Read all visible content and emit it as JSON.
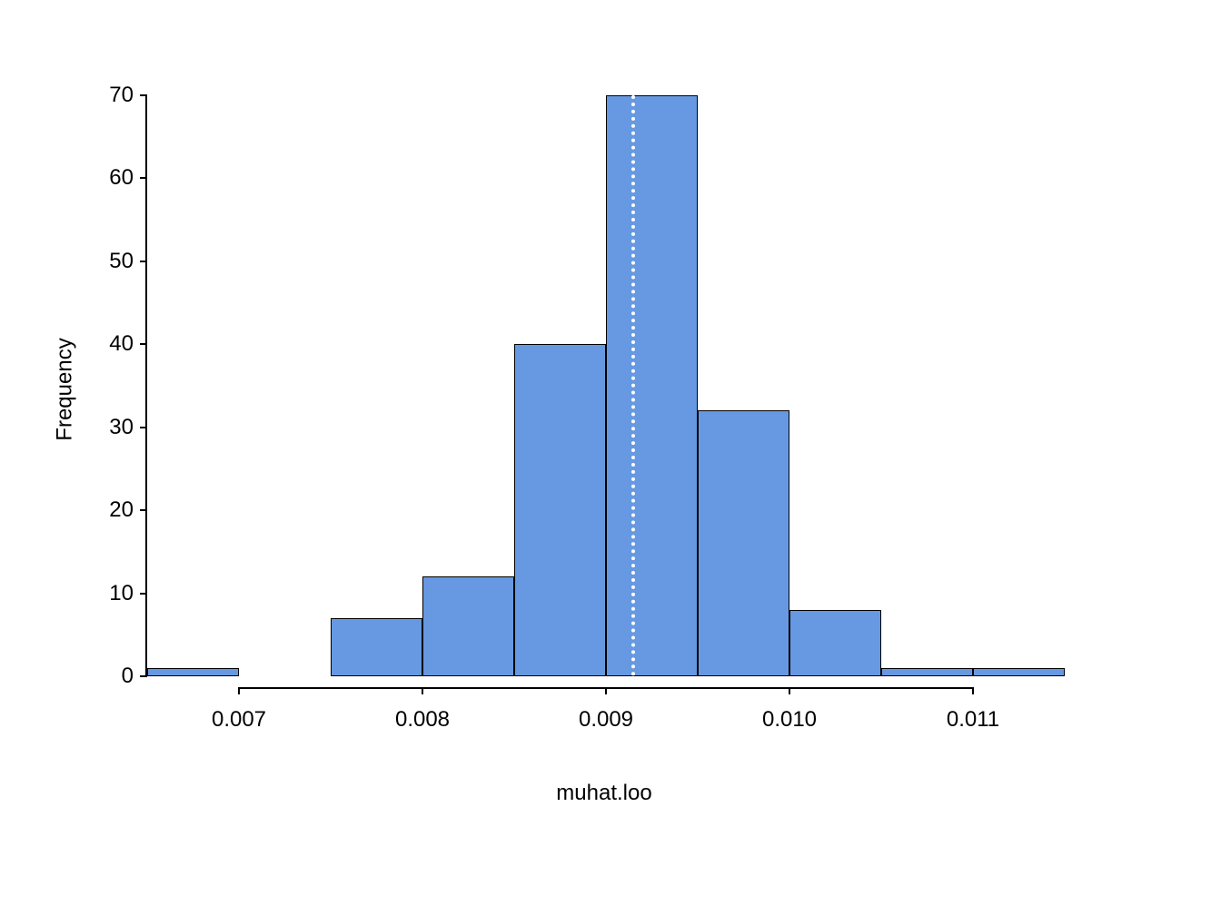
{
  "chart_data": {
    "type": "bar",
    "categories": [
      0.0065,
      0.007,
      0.0075,
      0.008,
      0.0085,
      0.009,
      0.0095,
      0.01,
      0.0105,
      0.011
    ],
    "values": [
      1,
      0,
      7,
      12,
      40,
      70,
      32,
      8,
      1,
      1
    ],
    "title": "",
    "xlabel": "muhat.loo",
    "ylabel": "Frequency",
    "ylim": [
      0,
      70
    ],
    "xlim": [
      0.0065,
      0.0115
    ],
    "vline": 0.00915,
    "x_ticks": [
      0.007,
      0.008,
      0.009,
      0.01,
      0.011
    ],
    "x_tick_labels": [
      "0.007",
      "0.008",
      "0.009",
      "0.010",
      "0.011"
    ],
    "y_ticks": [
      0,
      10,
      20,
      30,
      40,
      50,
      60,
      70
    ]
  }
}
